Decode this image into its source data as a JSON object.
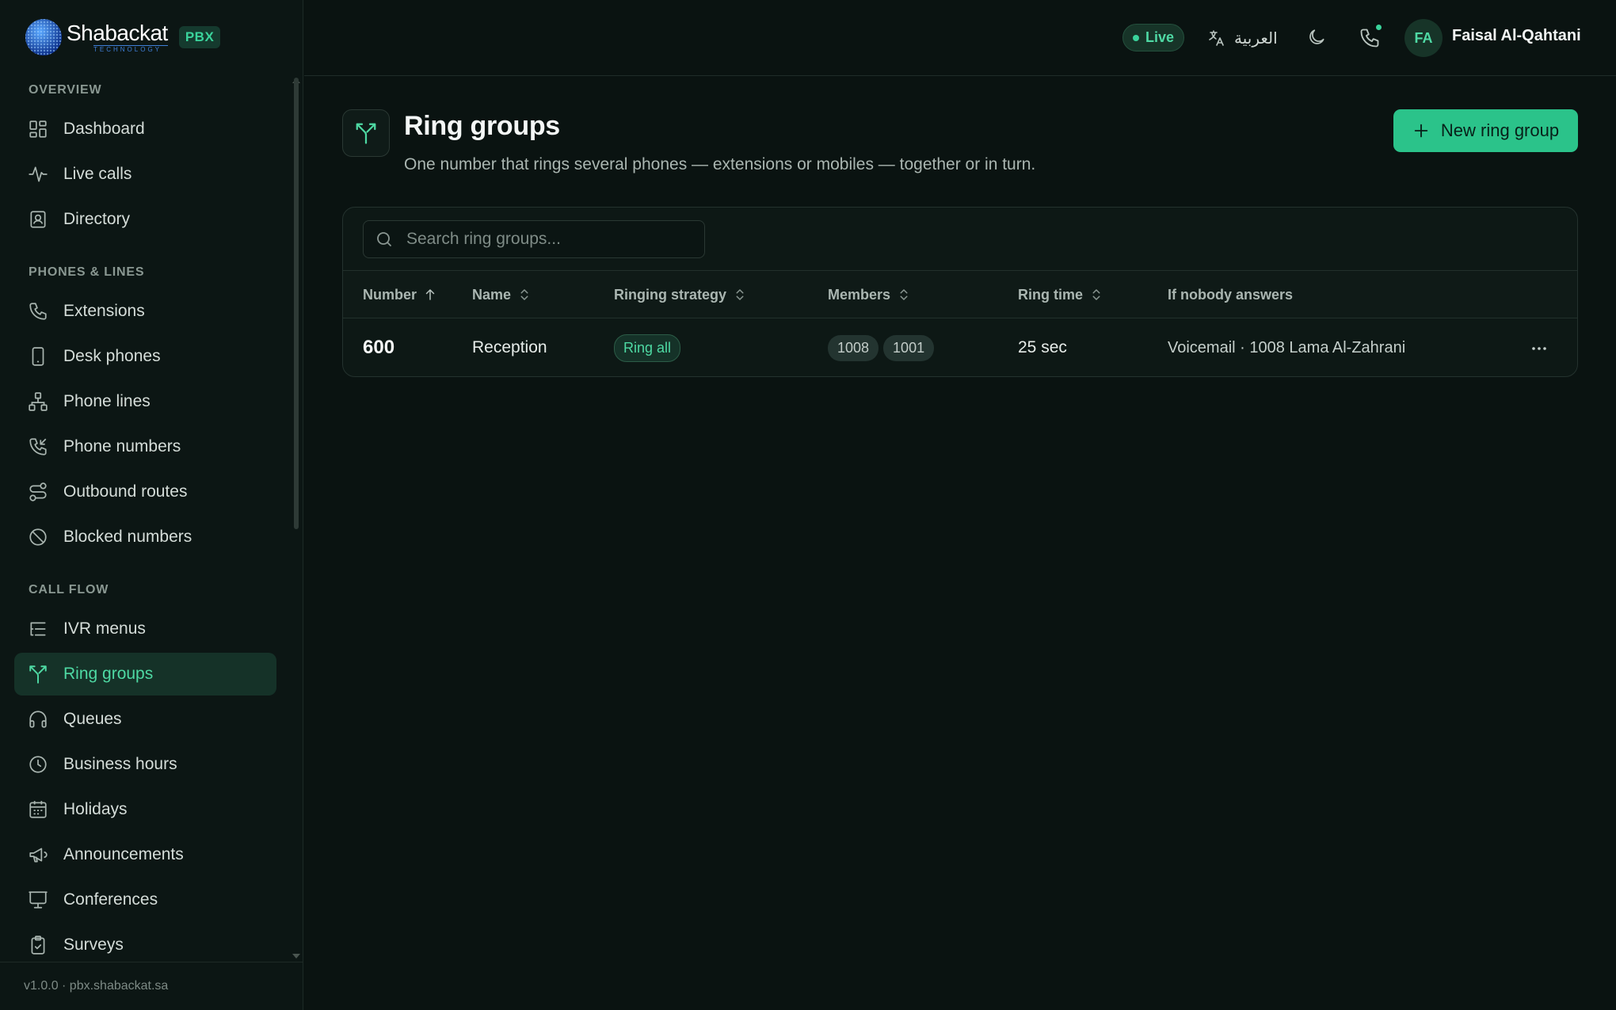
{
  "brand": {
    "name": "Shabackat",
    "tagline": "TECHNOLOGY",
    "badge": "PBX"
  },
  "sidebar": {
    "sections": [
      {
        "title": "OVERVIEW",
        "items": [
          {
            "label": "Dashboard",
            "icon": "dashboard-icon"
          },
          {
            "label": "Live calls",
            "icon": "activity-icon"
          },
          {
            "label": "Directory",
            "icon": "contact-book-icon"
          }
        ]
      },
      {
        "title": "PHONES & LINES",
        "items": [
          {
            "label": "Extensions",
            "icon": "phone-icon"
          },
          {
            "label": "Desk phones",
            "icon": "smartphone-icon"
          },
          {
            "label": "Phone lines",
            "icon": "network-icon"
          },
          {
            "label": "Phone numbers",
            "icon": "phone-incoming-icon"
          },
          {
            "label": "Outbound routes",
            "icon": "route-icon"
          },
          {
            "label": "Blocked numbers",
            "icon": "ban-icon"
          }
        ]
      },
      {
        "title": "CALL FLOW",
        "items": [
          {
            "label": "IVR menus",
            "icon": "list-tree-icon"
          },
          {
            "label": "Ring groups",
            "icon": "split-arrows-icon",
            "active": true
          },
          {
            "label": "Queues",
            "icon": "headphones-icon"
          },
          {
            "label": "Business hours",
            "icon": "clock-icon"
          },
          {
            "label": "Holidays",
            "icon": "calendar-icon"
          },
          {
            "label": "Announcements",
            "icon": "megaphone-icon"
          },
          {
            "label": "Conferences",
            "icon": "presentation-icon"
          },
          {
            "label": "Surveys",
            "icon": "clipboard-icon"
          }
        ]
      }
    ],
    "footer": "v1.0.0 · pbx.shabackat.sa"
  },
  "topbar": {
    "status": "Live",
    "language": "العربية",
    "user_initials": "FA",
    "user_name": "Faisal Al-Qahtani"
  },
  "page": {
    "title": "Ring groups",
    "subtitle": "One number that rings several phones — extensions or mobiles — together or in turn.",
    "new_button": "New ring group",
    "search_placeholder": "Search ring groups...",
    "columns": [
      "Number",
      "Name",
      "Ringing strategy",
      "Members",
      "Ring time",
      "If nobody answers"
    ],
    "rows": [
      {
        "number": "600",
        "name": "Reception",
        "strategy": "Ring all",
        "members": [
          "1008",
          "1001"
        ],
        "ring_time": "25 sec",
        "fallback": "Voicemail · 1008 Lama Al-Zahrani"
      }
    ]
  },
  "colors": {
    "accent": "#2bc38a",
    "background": "#0a1311",
    "active_item": "#153228"
  }
}
